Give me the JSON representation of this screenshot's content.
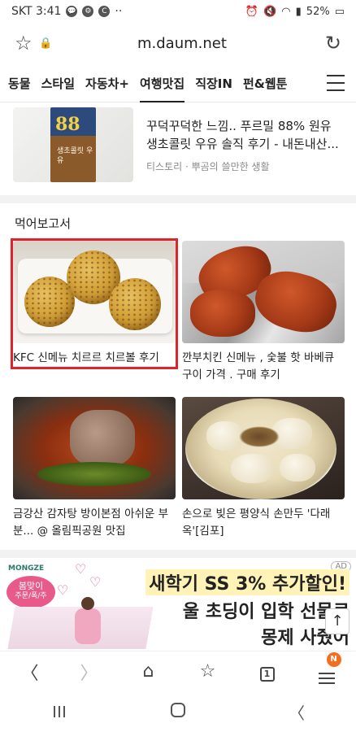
{
  "status_bar": {
    "carrier_time": "SKT 3:41",
    "icons": [
      "chat-icon",
      "settings-icon",
      "c-icon",
      "more-icon"
    ],
    "right_icons": [
      "alarm-icon",
      "mute-icon",
      "wifi-icon",
      "signal-icon"
    ],
    "battery": "52%"
  },
  "url_bar": {
    "url": "m.daum.net"
  },
  "tabs": [
    {
      "label": "동물"
    },
    {
      "label": "스타일"
    },
    {
      "label": "자동차+"
    },
    {
      "label": "여행맛집",
      "active": true
    },
    {
      "label": "직장IN"
    },
    {
      "label": "펀&웹툰"
    }
  ],
  "top_article": {
    "title": "꾸덕꾸덕한 느낌.. 푸르밀 88% 원유 생초콜릿 우유 솔직 후기 - 내돈내산...",
    "source": "티스토리 · 뿌곰의 쓸만한 생활",
    "thumb_badge": "88",
    "thumb_text": "생초콜릿 우유"
  },
  "section": {
    "title": "먹어보고서",
    "cards": [
      {
        "caption": "KFC 신메뉴 치르르 치르볼 후기"
      },
      {
        "caption": "깐부치킨 신메뉴 , 숯불 핫 바베큐 구이 가격 . 구매 후기"
      },
      {
        "caption": "금강산 감자탕 방이본점 아쉬운 부분... @ 올림픽공원 맛집"
      },
      {
        "caption": "손으로 빚은 평양식 손만두 '다래옥'[김포]"
      }
    ]
  },
  "ad": {
    "label": "AD",
    "logo": "MONGZE",
    "badge_main": "봄맞이",
    "badge_sub": "주문/폭/주",
    "line1": "새학기 SS 3% 추가할인!",
    "line2": "울 초딩이 입학 선물로",
    "line3": "몽제 사줬어"
  },
  "bottom_bar": {
    "tab_count": "1",
    "notification": "N"
  },
  "colors": {
    "highlight": "#e0222a",
    "notification": "#f07020"
  }
}
